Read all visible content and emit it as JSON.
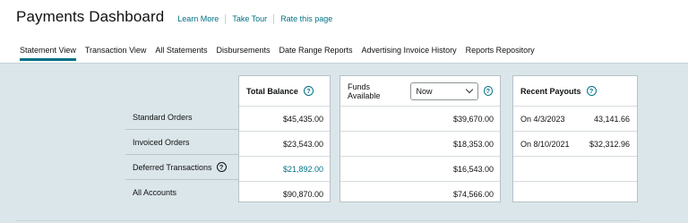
{
  "header": {
    "title": "Payments Dashboard",
    "links": [
      "Learn More",
      "Take Tour",
      "Rate this page"
    ]
  },
  "tabs": [
    {
      "label": "Statement View",
      "active": true
    },
    {
      "label": "Transaction View",
      "active": false
    },
    {
      "label": "All Statements",
      "active": false
    },
    {
      "label": "Disbursements",
      "active": false
    },
    {
      "label": "Date Range Reports",
      "active": false
    },
    {
      "label": "Advertising Invoice History",
      "active": false
    },
    {
      "label": "Reports Repository",
      "active": false
    }
  ],
  "rows": [
    "Standard Orders",
    "Invoiced Orders",
    "Deferred Transactions",
    "All Accounts"
  ],
  "total_balance": {
    "title": "Total Balance",
    "values": [
      "$45,435.00",
      "$23,543.00",
      "$21,892.00",
      "$90,870.00"
    ]
  },
  "funds_available": {
    "label": "Funds Available",
    "selected": "Now",
    "values": [
      "$39,670.00",
      "$18,353.00",
      "$16,543.00",
      "$74,566.00"
    ]
  },
  "recent_payouts": {
    "title": "Recent Payouts",
    "items": [
      {
        "date": "On 4/3/2023",
        "amount": "43,141.66"
      },
      {
        "date": "On 8/10/2021",
        "amount": "$32,312.96"
      }
    ]
  },
  "colors": {
    "accent": "#007185",
    "panel_bg": "#dbe6ea"
  }
}
